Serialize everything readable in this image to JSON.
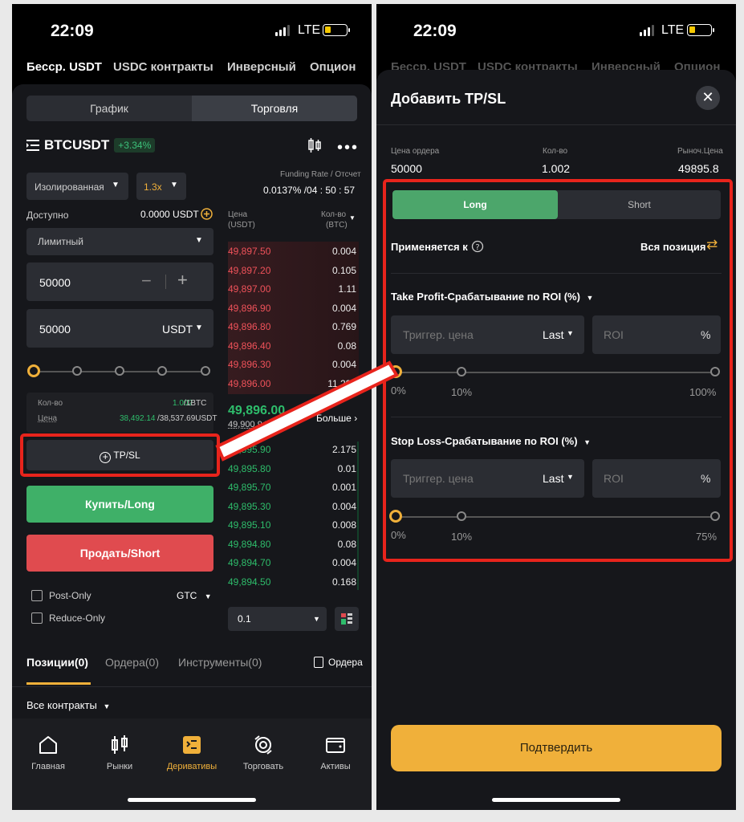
{
  "status": {
    "time": "22:09",
    "network": "LTE"
  },
  "left": {
    "top_tabs": [
      "Бесср. USDT",
      "USDC контракты",
      "Инверсный",
      "Опцион"
    ],
    "view_tabs": {
      "chart": "График",
      "trade": "Торговля"
    },
    "pair": "BTCUSDT",
    "change": "+3.34%",
    "margin_mode": "Изолированная",
    "leverage": "1.3x",
    "funding_label": "Funding Rate / Отсчет",
    "funding_value": "0.0137% /04 : 50 : 57",
    "available_label": "Доступно",
    "available_value": "0.0000 USDT",
    "order_type": "Лимитный",
    "price_input": "50000",
    "qty_input": "50000",
    "qty_unit": "USDT",
    "qty_label": "Кол-во",
    "qty_val": "1.002",
    "qty_max": "/1BTC",
    "price_label": "Цена",
    "price_val": "38,492.14",
    "price_max": "/38,537.69USDT",
    "tpsl": "TP/SL",
    "buy": "Купить/Long",
    "sell": "Продать/Short",
    "post_only": "Post-Only",
    "tif": "GTC",
    "reduce_only": "Reduce-Only",
    "ob_price_hdr": "Цена",
    "ob_price_unit": "(USDT)",
    "ob_qty_hdr": "Кол-во",
    "ob_qty_unit": "(BTC)",
    "asks": [
      [
        "49,897.50",
        "0.004"
      ],
      [
        "49,897.20",
        "0.105"
      ],
      [
        "49,897.00",
        "1.11"
      ],
      [
        "49,896.90",
        "0.004"
      ],
      [
        "49,896.80",
        "0.769"
      ],
      [
        "49,896.40",
        "0.08"
      ],
      [
        "49,896.30",
        "0.004"
      ],
      [
        "49,896.00",
        "11.293"
      ]
    ],
    "last_price": "49,896.00",
    "mark_price": "49,900.94",
    "more": "Больше",
    "bids": [
      [
        "49,895.90",
        "2.175"
      ],
      [
        "49,895.80",
        "0.01"
      ],
      [
        "49,895.70",
        "0.001"
      ],
      [
        "49,895.30",
        "0.004"
      ],
      [
        "49,895.10",
        "0.008"
      ],
      [
        "49,894.80",
        "0.08"
      ],
      [
        "49,894.70",
        "0.004"
      ],
      [
        "49,894.50",
        "0.168"
      ]
    ],
    "depth": "0.1",
    "bottom_tabs": {
      "positions": "Позиции(0)",
      "orders": "Ордера(0)",
      "tools": "Инструменты(0)",
      "orders_link": "Ордера"
    },
    "all_contracts": "Все контракты",
    "nav": [
      "Главная",
      "Рынки",
      "Деривативы",
      "Торговать",
      "Активы"
    ]
  },
  "right": {
    "title": "Добавить TP/SL",
    "order_price_label": "Цена ордера",
    "order_price": "50000",
    "qty_label": "Кол-во",
    "qty": "1.002",
    "market_label": "Рыноч.Цена",
    "market_price": "49895.8",
    "long": "Long",
    "short": "Short",
    "applies_to": "Применяется к",
    "whole_position": "Вся позиция",
    "tp_title": "Take Profit-Срабатывание по ROI (%)",
    "trigger_placeholder": "Триггер. цена",
    "last": "Last",
    "roi": "ROI",
    "percent": "%",
    "tp_marks": [
      "0%",
      "10%",
      "100%"
    ],
    "sl_title": "Stop Loss-Срабатывание по ROI (%)",
    "sl_marks": [
      "0%",
      "10%",
      "75%"
    ],
    "confirm": "Подтвердить"
  },
  "colors": {
    "accent": "#f0b03a",
    "buy": "#2ebd6b",
    "sell": "#f0525a",
    "long_btn": "#4ca66b",
    "highlight": "#e8241c"
  }
}
